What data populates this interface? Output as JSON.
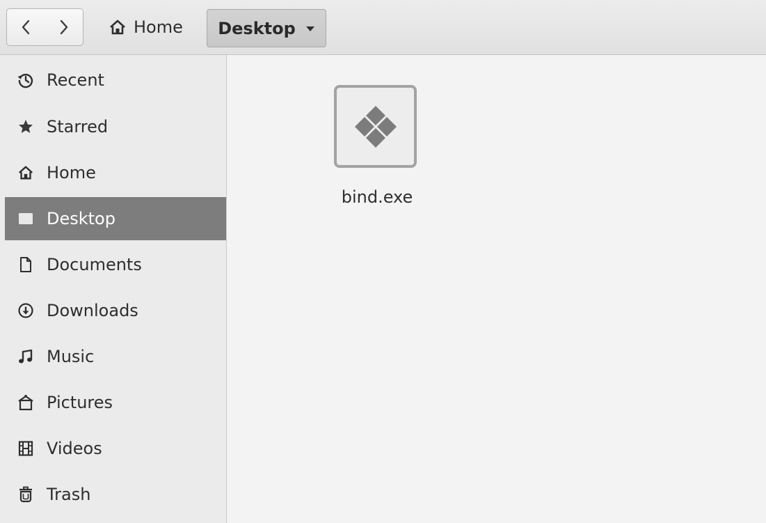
{
  "header": {
    "back_icon": "chevron-left-icon",
    "forward_icon": "chevron-right-icon",
    "path": [
      {
        "label": "Home",
        "icon": "home-icon"
      },
      {
        "label": "Desktop",
        "icon": "dropdown-arrow-icon",
        "current": true
      }
    ]
  },
  "sidebar": {
    "selected": "Desktop",
    "items": [
      {
        "label": "Recent",
        "icon": "clock-icon"
      },
      {
        "label": "Starred",
        "icon": "star-icon"
      },
      {
        "label": "Home",
        "icon": "home-icon"
      },
      {
        "label": "Desktop",
        "icon": "desktop-icon"
      },
      {
        "label": "Documents",
        "icon": "document-icon"
      },
      {
        "label": "Downloads",
        "icon": "download-icon"
      },
      {
        "label": "Music",
        "icon": "music-note-icon"
      },
      {
        "label": "Pictures",
        "icon": "picture-icon"
      },
      {
        "label": "Videos",
        "icon": "film-icon"
      },
      {
        "label": "Trash",
        "icon": "trash-icon"
      }
    ]
  },
  "content": {
    "files": [
      {
        "name": "bind.exe",
        "icon": "executable-file-icon"
      }
    ]
  },
  "colors": {
    "selected_row": "#7d7d7d",
    "sidebar_bg": "#ebebeb",
    "content_bg": "#f3f3f3",
    "text": "#2e2e2e"
  }
}
